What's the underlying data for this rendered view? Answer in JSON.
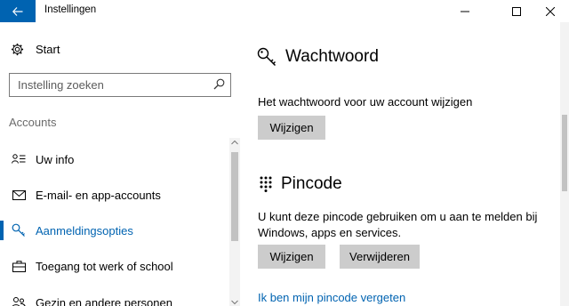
{
  "window": {
    "title": "Instellingen",
    "accent": "#0063b1"
  },
  "sidebar": {
    "start_label": "Start",
    "search_placeholder": "Instelling zoeken",
    "section_header": "Accounts",
    "items": [
      {
        "label": "Uw info",
        "icon": "user-info-icon"
      },
      {
        "label": "E-mail- en app-accounts",
        "icon": "mail-icon"
      },
      {
        "label": "Aanmeldingsopties",
        "icon": "key-icon",
        "active": true
      },
      {
        "label": "Toegang tot werk of school",
        "icon": "briefcase-icon"
      },
      {
        "label": "Gezin en andere personen",
        "icon": "people-icon"
      }
    ]
  },
  "main": {
    "password": {
      "title": "Wachtwoord",
      "icon": "key-icon",
      "description": "Het wachtwoord voor uw account wijzigen",
      "change_label": "Wijzigen"
    },
    "pin": {
      "title": "Pincode",
      "icon": "keypad-icon",
      "description_line1": "U kunt deze pincode gebruiken om u aan te melden bij",
      "description_line2": "Windows, apps en services.",
      "change_label": "Wijzigen",
      "remove_label": "Verwijderen",
      "forgot_link": "Ik ben mijn pincode vergeten"
    }
  }
}
